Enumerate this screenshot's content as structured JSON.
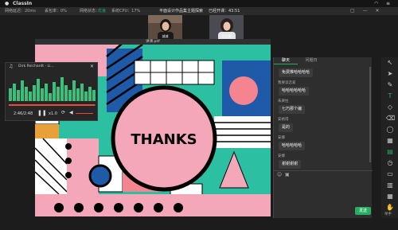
{
  "menubar": {
    "apple": "",
    "app_name": "ClassIn"
  },
  "statusbar": {
    "latency": "网络延迟：20ms",
    "packet_loss": "丢包率：0%",
    "net_status_label": "网络状态：",
    "net_status_value": "优良",
    "cpu": "系统CPU：17%",
    "class_title": "平面设计作品集主题探索",
    "elapsed": "已经开课：43:51"
  },
  "cameras": [
    {
      "name": "减减"
    },
    {
      "name": "吕艾美"
    }
  ],
  "document": {
    "title": "讲课.pdf",
    "center_text": "THANKS"
  },
  "music_player": {
    "track": "Dirk Reichardt - Li...",
    "time": "2:46/2:48",
    "speed": "x1.0",
    "progress_fraction": 0.99
  },
  "chat": {
    "tabs": [
      "聊天",
      "问题日"
    ],
    "messages": [
      {
        "name": "",
        "text": "免费推哈哈哈哈"
      },
      {
        "name": "我要读恋爱",
        "text": "哈哈哈哈哈哈"
      },
      {
        "name": "朱楽拉",
        "text": "七巧那个编"
      },
      {
        "name": "安格得",
        "text": "是的"
      },
      {
        "name": "安娜",
        "text": "哈哈哈哈哈"
      },
      {
        "name": "安娜",
        "text": "谢谢谢谢"
      }
    ],
    "send_label": "发送"
  },
  "toolbar": {
    "items": [
      "arrow-icon",
      "pointer-icon",
      "pen-icon",
      "text-icon",
      "eraser-icon",
      "trash-icon",
      "shapes-icon",
      "image-icon",
      "chat-icon",
      "timer-icon",
      "save-icon",
      "toolbox-icon",
      "calendar-icon",
      "raise-hand-icon"
    ],
    "raise_hand_label": "举手"
  },
  "colors": {
    "accent_green": "#27ae60",
    "slide_teal": "#2dbfa1",
    "slide_pink": "#f4a7b9",
    "slide_blue": "#1e5aa8"
  }
}
